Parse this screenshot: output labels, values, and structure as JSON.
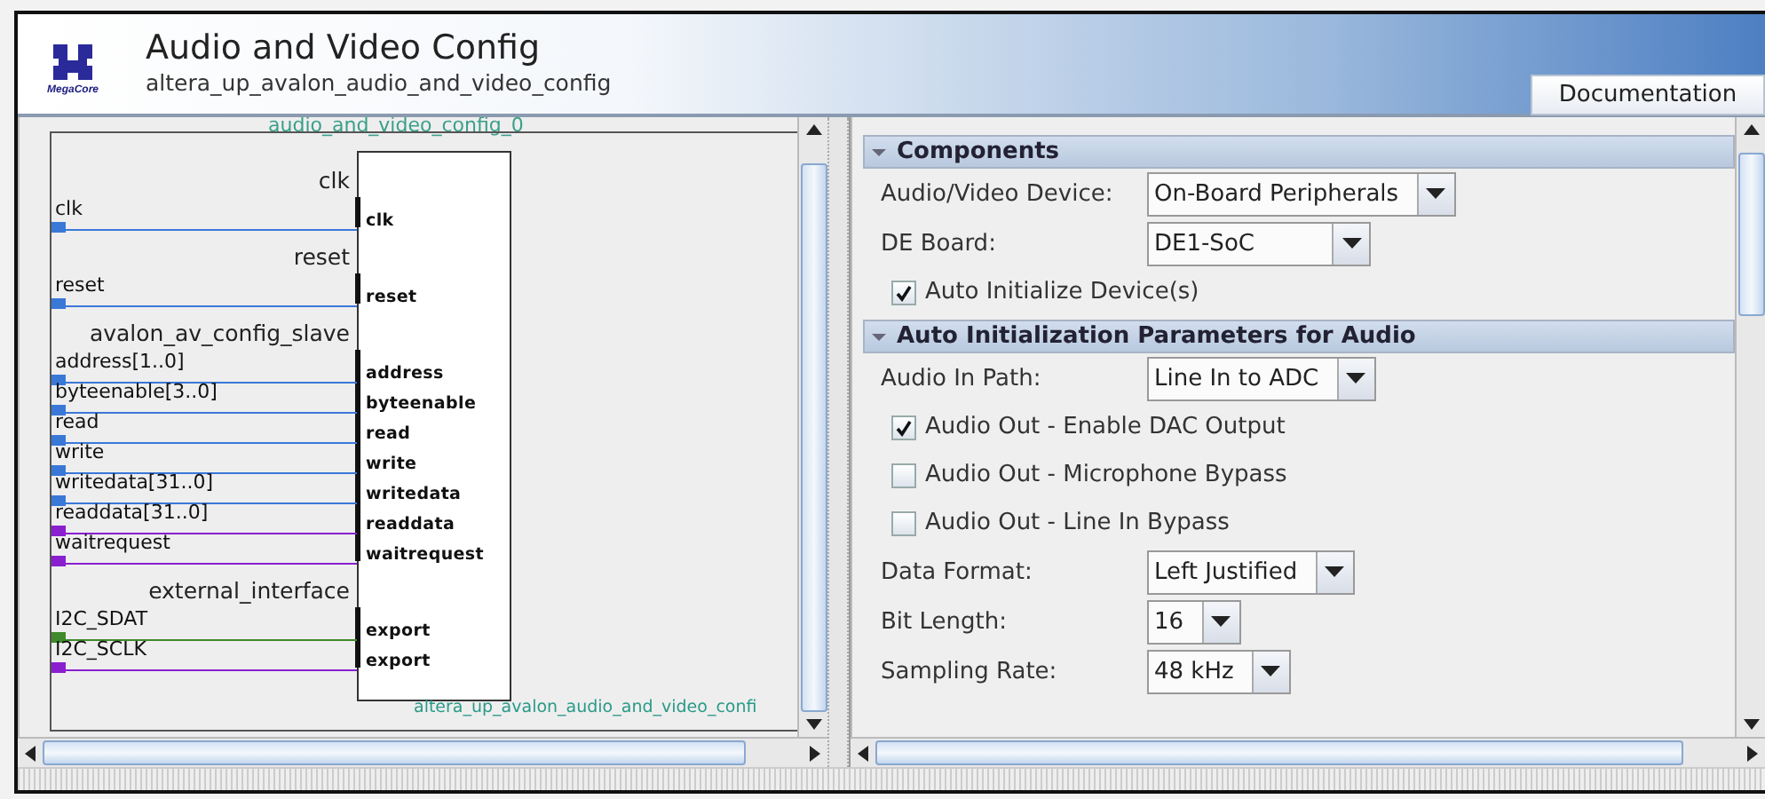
{
  "header": {
    "logo_text": "MegaCore",
    "title": "Audio and Video Config",
    "subtitle": "altera_up_avalon_audio_and_video_config",
    "documentation_button": "Documentation"
  },
  "symbol": {
    "instance_name": "audio_and_video_config_0",
    "module_name": "altera_up_avalon_audio_and_video_confi",
    "interfaces": [
      {
        "name": "clk",
        "signals": [
          {
            "name": "clk",
            "port": "clk",
            "color": "#3a78d8"
          }
        ]
      },
      {
        "name": "reset",
        "signals": [
          {
            "name": "reset",
            "port": "reset",
            "color": "#3a78d8"
          }
        ]
      },
      {
        "name": "avalon_av_config_slave",
        "signals": [
          {
            "name": "address[1..0]",
            "port": "address",
            "color": "#3a78d8"
          },
          {
            "name": "byteenable[3..0]",
            "port": "byteenable",
            "color": "#3a78d8"
          },
          {
            "name": "read",
            "port": "read",
            "color": "#3a78d8"
          },
          {
            "name": "write",
            "port": "write",
            "color": "#3a78d8"
          },
          {
            "name": "writedata[31..0]",
            "port": "writedata",
            "color": "#3a78d8"
          },
          {
            "name": "readdata[31..0]",
            "port": "readdata",
            "color": "#8a1fd0"
          },
          {
            "name": "waitrequest",
            "port": "waitrequest",
            "color": "#8a1fd0"
          }
        ]
      },
      {
        "name": "external_interface",
        "signals": [
          {
            "name": "I2C_SDAT",
            "port": "export",
            "color": "#3f8a2c"
          },
          {
            "name": "I2C_SCLK",
            "port": "export",
            "color": "#8a1fd0"
          }
        ]
      }
    ]
  },
  "parameters": {
    "sections": [
      {
        "title": "Components",
        "expanded": true,
        "rows": [
          {
            "kind": "dropdown",
            "label": "Audio/Video Device:",
            "value": "On-Board Peripherals"
          },
          {
            "kind": "dropdown",
            "label": "DE Board:",
            "value": "DE1-SoC"
          },
          {
            "kind": "checkbox",
            "label": "Auto Initialize Device(s)",
            "checked": true
          }
        ]
      },
      {
        "title": "Auto Initialization Parameters for Audio",
        "expanded": true,
        "rows": [
          {
            "kind": "dropdown",
            "label": "Audio In Path:",
            "value": "Line In to ADC"
          },
          {
            "kind": "checkbox",
            "label": "Audio Out - Enable DAC Output",
            "checked": true
          },
          {
            "kind": "checkbox",
            "label": "Audio Out - Microphone Bypass",
            "checked": false
          },
          {
            "kind": "checkbox",
            "label": "Audio Out - Line In Bypass",
            "checked": false
          },
          {
            "kind": "dropdown",
            "label": "Data Format:",
            "value": "Left Justified"
          },
          {
            "kind": "dropdown",
            "label": "Bit Length:",
            "value": "16"
          },
          {
            "kind": "dropdown",
            "label": "Sampling Rate:",
            "value": "48 kHz"
          }
        ]
      }
    ]
  }
}
